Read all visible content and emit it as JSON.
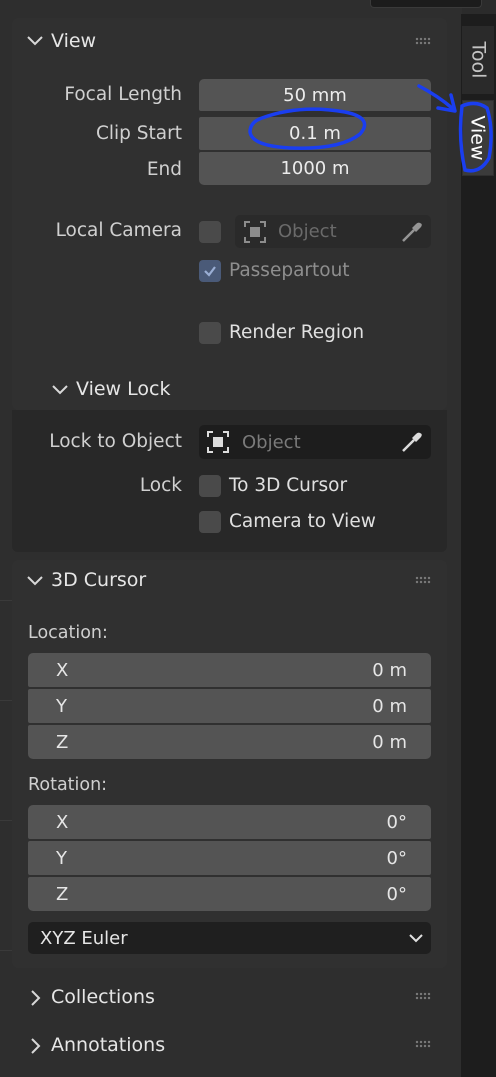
{
  "tabs": {
    "tool": "Tool",
    "view": "View"
  },
  "view_panel": {
    "title": "View",
    "focal_length_label": "Focal Length",
    "focal_length_value": "50 mm",
    "clip_start_label": "Clip Start",
    "clip_start_value": "0.1 m",
    "clip_end_label": "End",
    "clip_end_value": "1000 m",
    "local_camera_label": "Local Camera",
    "local_camera_placeholder": "Object",
    "local_camera_enabled": false,
    "passepartout_label": "Passepartout",
    "passepartout_checked": true,
    "render_region_label": "Render Region",
    "render_region_checked": false
  },
  "view_lock": {
    "title": "View Lock",
    "lock_to_object_label": "Lock to Object",
    "lock_object_placeholder": "Object",
    "lock_label": "Lock",
    "to_3d_cursor_label": "To 3D Cursor",
    "to_3d_cursor_checked": false,
    "camera_to_view_label": "Camera to View",
    "camera_to_view_checked": false
  },
  "cursor_panel": {
    "title": "3D Cursor",
    "location_label": "Location:",
    "location": [
      {
        "axis": "X",
        "value": "0 m"
      },
      {
        "axis": "Y",
        "value": "0 m"
      },
      {
        "axis": "Z",
        "value": "0 m"
      }
    ],
    "rotation_label": "Rotation:",
    "rotation": [
      {
        "axis": "X",
        "value": "0°"
      },
      {
        "axis": "Y",
        "value": "0°"
      },
      {
        "axis": "Z",
        "value": "0°"
      }
    ],
    "rotation_mode": "XYZ Euler"
  },
  "collapsed_panels": [
    "Collections",
    "Annotations"
  ],
  "icons": {
    "expanded": "chevron-down-icon",
    "collapsed": "chevron-right-icon",
    "drag": "drag-handle-icon",
    "object": "object-icon",
    "eyedropper": "eyedropper-icon",
    "check": "check-icon",
    "dropdown": "chevron-down-icon"
  },
  "colors": {
    "panel_bg": "#303030",
    "field_bg": "#545454",
    "checkbox_checked": "#4a5a78",
    "annotation": "#1a3ef0"
  }
}
